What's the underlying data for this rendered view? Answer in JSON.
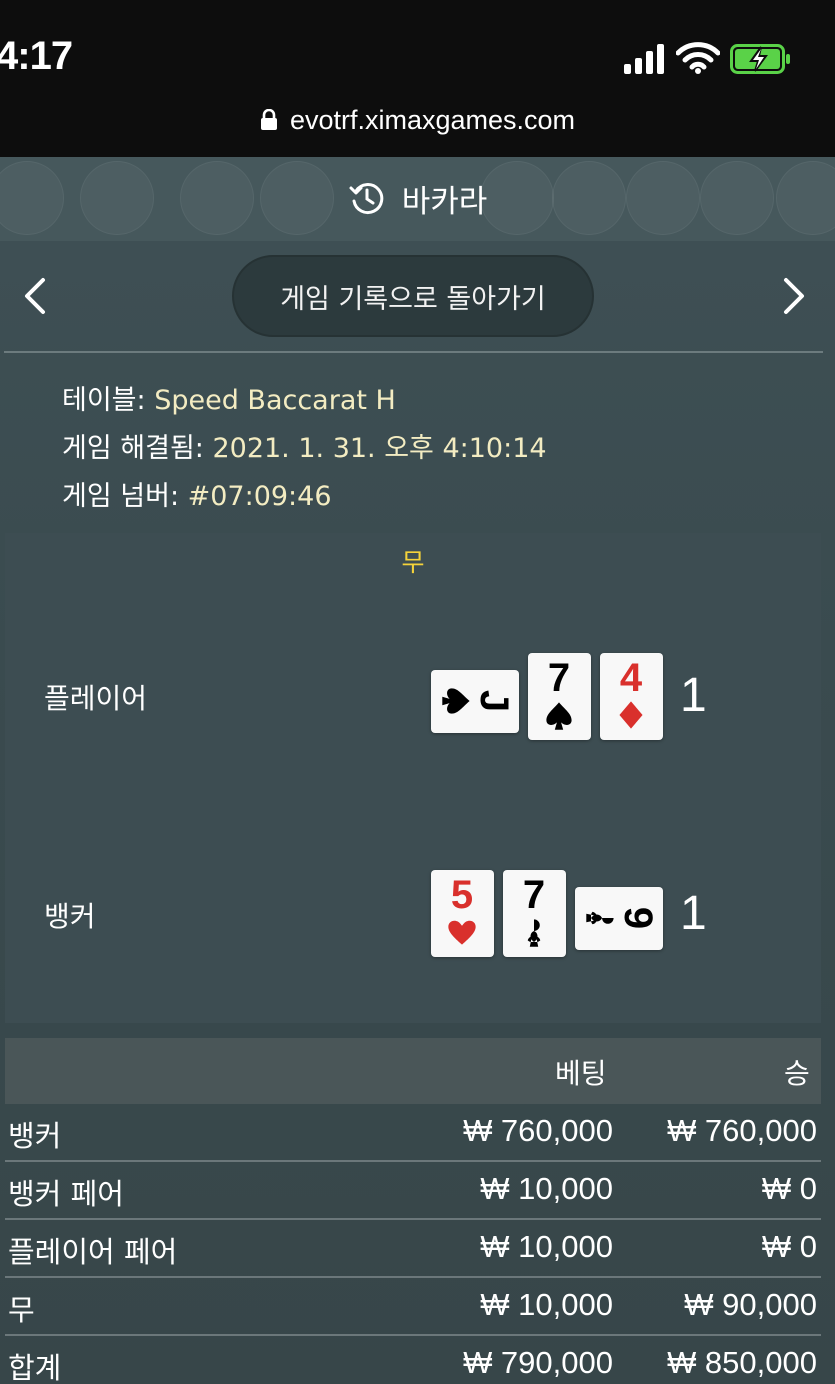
{
  "status_bar": {
    "time": "4:17",
    "url": "evotrf.ximaxgames.com",
    "icons": [
      "signal-icon",
      "wifi-icon",
      "battery-charging-icon",
      "lock-icon"
    ]
  },
  "header": {
    "title": "바카라",
    "icon": "history-icon"
  },
  "nav": {
    "back_label": "게임 기록으로 돌아가기",
    "prev_icon": "chevron-left-icon",
    "next_icon": "chevron-right-icon"
  },
  "info": {
    "table_key": "테이블: ",
    "table_value": "Speed Baccarat H",
    "resolved_key": "게임 해결됨: ",
    "resolved_value": "2021. 1. 31. 오후 4:10:14",
    "number_key": "게임 넘버: ",
    "number_value": "#07:09:46"
  },
  "result": {
    "outcome": "무",
    "player": {
      "label": "플레이어",
      "score": "1",
      "cards": [
        {
          "rank": "J",
          "suit": "spade",
          "color": "#000000",
          "rotated": true
        },
        {
          "rank": "7",
          "suit": "spade",
          "color": "#000000",
          "rotated": false
        },
        {
          "rank": "4",
          "suit": "diamond",
          "color": "#d9302c",
          "rotated": false
        }
      ]
    },
    "banker": {
      "label": "뱅커",
      "score": "1",
      "cards": [
        {
          "rank": "5",
          "suit": "heart",
          "color": "#d9302c",
          "rotated": false
        },
        {
          "rank": "7",
          "suit": "club",
          "color": "#000000",
          "rotated": false
        },
        {
          "rank": "9",
          "suit": "club",
          "color": "#000000",
          "rotated": true
        }
      ]
    }
  },
  "bets_table": {
    "headers": {
      "bet": "베팅",
      "win": "승"
    },
    "rows": [
      {
        "label": "뱅커",
        "bet": "₩ 760,000",
        "win": "₩ 760,000"
      },
      {
        "label": "뱅커 페어",
        "bet": "₩ 10,000",
        "win": "₩ 0"
      },
      {
        "label": "플레이어 페어",
        "bet": "₩ 10,000",
        "win": "₩ 0"
      },
      {
        "label": "무",
        "bet": "₩ 10,000",
        "win": "₩ 90,000"
      }
    ],
    "total": {
      "label": "합계",
      "bet": "₩ 790,000",
      "win": "₩ 850,000"
    }
  },
  "colors": {
    "accent_yellow": "#f5d33a",
    "info_value": "#f3ecc2",
    "battery_green": "#5ad248",
    "red_suit": "#d9302c"
  }
}
